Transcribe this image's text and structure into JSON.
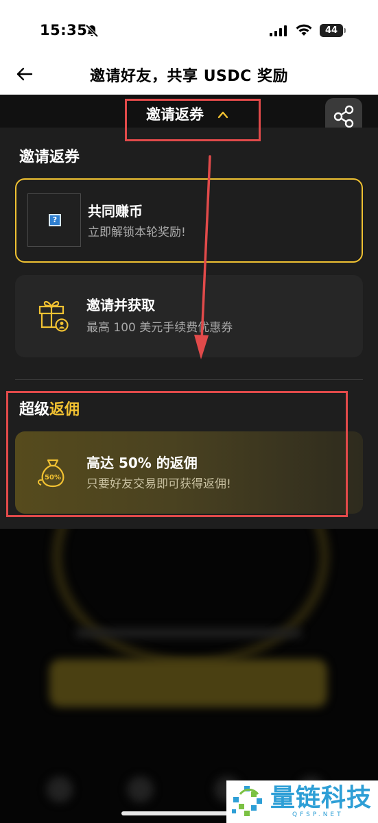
{
  "status_bar": {
    "time": "15:35",
    "battery": "44",
    "icons": [
      "bell-off-icon",
      "signal-icon",
      "wifi-icon",
      "battery-icon"
    ]
  },
  "nav": {
    "title": "邀请好友，共享 USDC 奖励",
    "back_icon": "back-arrow-icon"
  },
  "dropdown": {
    "label": "邀请返券",
    "chevron_icon": "chevron-up-icon",
    "share_icon": "share-icon"
  },
  "section_coupon": {
    "title": "邀请返券",
    "cards": [
      {
        "title": "共同赚币",
        "subtitle": "立即解锁本轮奖励!",
        "icon": "missing-image-icon"
      },
      {
        "title": "邀请并获取",
        "subtitle": "最高 100 美元手续费优惠券",
        "icon": "gift-user-icon"
      }
    ]
  },
  "section_rebate": {
    "title_prefix": "超级",
    "title_accent": "返佣",
    "card": {
      "title": "高达 50% 的返佣",
      "subtitle": "只要好友交易即可获得返佣!",
      "icon": "money-bag-icon",
      "badge": "50%"
    }
  },
  "watermark": {
    "text": "量链科技",
    "sub": "QFSP.NET"
  },
  "colors": {
    "accent": "#f2c232",
    "panel_bg": "#1e1e1e",
    "annotation": "#e14a4a"
  }
}
